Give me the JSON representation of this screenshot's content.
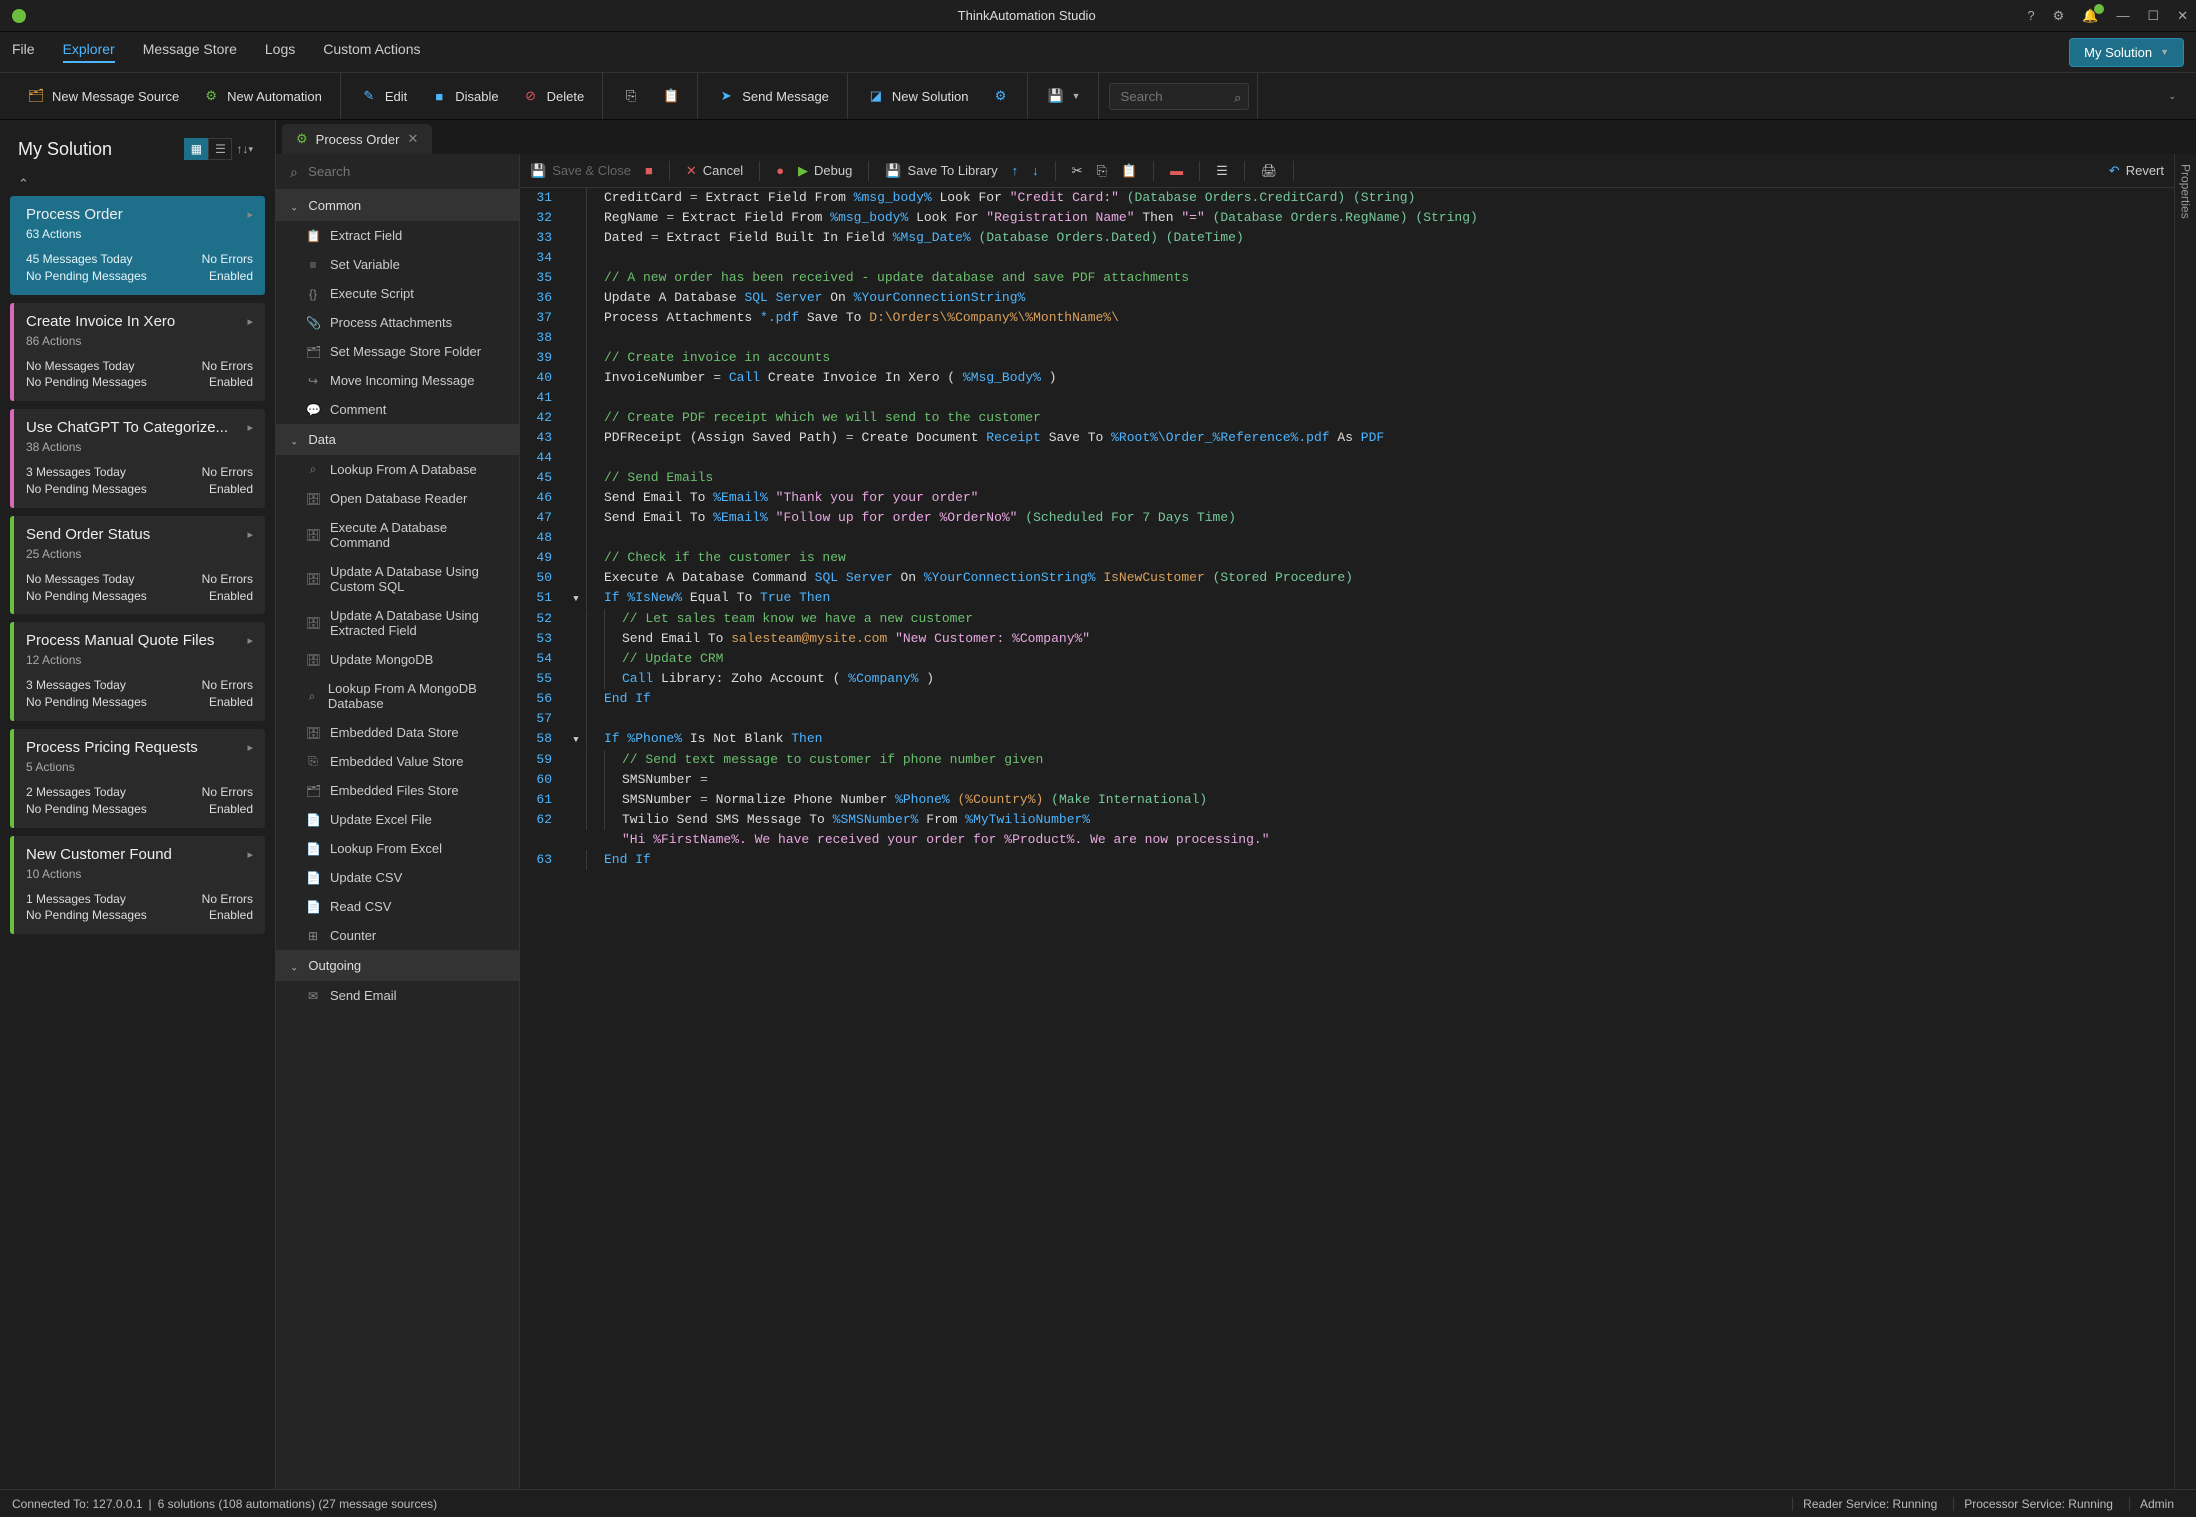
{
  "title": "ThinkAutomation Studio",
  "menubar": [
    "File",
    "Explorer",
    "Message Store",
    "Logs",
    "Custom Actions"
  ],
  "menubar_active": 1,
  "solution_dd": "My Solution",
  "toolbar": {
    "new_msg_src": "New Message Source",
    "new_auto": "New Automation",
    "edit": "Edit",
    "disable": "Disable",
    "delete": "Delete",
    "send_msg": "Send Message",
    "new_sol": "New Solution",
    "search_ph": "Search"
  },
  "left": {
    "title": "My Solution",
    "cards": [
      {
        "title": "Process Order",
        "sub": "63 Actions",
        "msg": "45 Messages Today",
        "pend": "No Pending Messages",
        "err": "No Errors",
        "en": "Enabled",
        "cls": "active"
      },
      {
        "title": "Create Invoice In Xero",
        "sub": "86 Actions",
        "msg": "No Messages Today",
        "pend": "No Pending Messages",
        "err": "No Errors",
        "en": "Enabled",
        "cls": "pink"
      },
      {
        "title": "Use ChatGPT To Categorize...",
        "sub": "38 Actions",
        "msg": "3 Messages Today",
        "pend": "No Pending Messages",
        "err": "No Errors",
        "en": "Enabled",
        "cls": "pink"
      },
      {
        "title": "Send Order Status",
        "sub": "25 Actions",
        "msg": "No Messages Today",
        "pend": "No Pending Messages",
        "err": "No Errors",
        "en": "Enabled",
        "cls": ""
      },
      {
        "title": "Process Manual Quote Files",
        "sub": "12 Actions",
        "msg": "3 Messages Today",
        "pend": "No Pending Messages",
        "err": "No Errors",
        "en": "Enabled",
        "cls": ""
      },
      {
        "title": "Process Pricing Requests",
        "sub": "5 Actions",
        "msg": "2 Messages Today",
        "pend": "No Pending Messages",
        "err": "No Errors",
        "en": "Enabled",
        "cls": ""
      },
      {
        "title": "New Customer Found",
        "sub": "10 Actions",
        "msg": "1 Messages Today",
        "pend": "No Pending Messages",
        "err": "No Errors",
        "en": "Enabled",
        "cls": ""
      }
    ]
  },
  "tab": {
    "label": "Process Order"
  },
  "action_search_ph": "Search",
  "action_groups": [
    {
      "name": "Common",
      "items": [
        {
          "i": "📋",
          "l": "Extract Field"
        },
        {
          "i": "≡",
          "l": "Set Variable"
        },
        {
          "i": "{}",
          "l": "Execute Script"
        },
        {
          "i": "📎",
          "l": "Process Attachments"
        },
        {
          "i": "🗂",
          "l": "Set Message Store Folder"
        },
        {
          "i": "↪",
          "l": "Move Incoming Message"
        },
        {
          "i": "💬",
          "l": "Comment"
        }
      ]
    },
    {
      "name": "Data",
      "items": [
        {
          "i": "⌕",
          "l": "Lookup From A Database"
        },
        {
          "i": "🗄",
          "l": "Open Database Reader"
        },
        {
          "i": "🗄",
          "l": "Execute A Database Command"
        },
        {
          "i": "🗄",
          "l": "Update A Database Using Custom SQL"
        },
        {
          "i": "🗄",
          "l": "Update A Database Using Extracted Field"
        },
        {
          "i": "🗄",
          "l": "Update MongoDB"
        },
        {
          "i": "⌕",
          "l": "Lookup From A MongoDB Database"
        },
        {
          "i": "🗄",
          "l": "Embedded Data Store"
        },
        {
          "i": "⎘",
          "l": "Embedded Value Store"
        },
        {
          "i": "🗂",
          "l": "Embedded Files Store"
        },
        {
          "i": "📄",
          "l": "Update Excel File"
        },
        {
          "i": "📄",
          "l": "Lookup From Excel"
        },
        {
          "i": "📄",
          "l": "Update CSV"
        },
        {
          "i": "📄",
          "l": "Read CSV"
        },
        {
          "i": "⊞",
          "l": "Counter"
        }
      ]
    },
    {
      "name": "Outgoing",
      "items": [
        {
          "i": "✉",
          "l": "Send Email"
        }
      ]
    }
  ],
  "code_toolbar": {
    "save_close": "Save & Close",
    "cancel": "Cancel",
    "debug": "Debug",
    "save_lib": "Save To Library",
    "revert": "Revert"
  },
  "code": [
    {
      "n": 31,
      "h": "<span class='c-fn'>CreditCard</span> <span class='c-op'>=</span> Extract Field From <span class='c-var'>%msg_body%</span> Look For <span class='c-str'>\"Credit Card:\"</span> <span class='c-db'>(Database Orders.CreditCard) (String)</span>"
    },
    {
      "n": 32,
      "h": "<span class='c-fn'>RegName</span> <span class='c-op'>=</span> Extract Field From <span class='c-var'>%msg_body%</span> Look For <span class='c-str'>\"Registration Name\"</span> Then <span class='c-str'>\"=\"</span> <span class='c-db'>(Database Orders.RegName) (String)</span>"
    },
    {
      "n": 33,
      "h": "<span class='c-fn'>Dated</span> <span class='c-op'>=</span> Extract Field Built In Field <span class='c-var'>%Msg_Date%</span> <span class='c-db'>(Database Orders.Dated) (DateTime)</span>"
    },
    {
      "n": 34,
      "h": ""
    },
    {
      "n": 35,
      "h": "<span class='c-cmt'>// A new order has been received - update database and save PDF attachments</span>"
    },
    {
      "n": 36,
      "h": "Update A Database <span class='c-var'>SQL Server</span> On <span class='c-var'>%YourConnectionString%</span>"
    },
    {
      "n": 37,
      "h": "Process Attachments <span class='c-var'>*.pdf</span> Save To <span class='c-kw'>D:\\Orders\\%Company%\\%MonthName%\\</span>"
    },
    {
      "n": 38,
      "h": ""
    },
    {
      "n": 39,
      "h": "<span class='c-cmt'>// Create invoice in accounts</span>"
    },
    {
      "n": 40,
      "h": "<span class='c-fn'>InvoiceNumber</span> <span class='c-op'>=</span> <span class='c-var'>Call</span> Create Invoice In Xero ( <span class='c-var'>%Msg_Body%</span> )"
    },
    {
      "n": 41,
      "h": ""
    },
    {
      "n": 42,
      "h": "<span class='c-cmt'>// Create PDF receipt which we will send to the customer</span>"
    },
    {
      "n": 43,
      "h": "<span class='c-fn'>PDFReceipt (Assign Saved Path)</span> <span class='c-op'>=</span> Create Document <span class='c-var'>Receipt</span> Save To <span class='c-var'>%Root%\\Order_%Reference%.pdf</span> As <span class='c-var'>PDF</span>"
    },
    {
      "n": 44,
      "h": ""
    },
    {
      "n": 45,
      "h": "<span class='c-cmt'>// Send Emails</span>"
    },
    {
      "n": 46,
      "h": "Send Email To <span class='c-var'>%Email%</span> <span class='c-str'>\"Thank you for your order\"</span>"
    },
    {
      "n": 47,
      "h": "Send Email To <span class='c-var'>%Email%</span> <span class='c-str'>\"Follow up for order %OrderNo%\"</span> <span class='c-db'>(Scheduled For 7 Days Time)</span>"
    },
    {
      "n": 48,
      "h": ""
    },
    {
      "n": 49,
      "h": "<span class='c-cmt'>// Check if the customer is new</span>"
    },
    {
      "n": 50,
      "h": "Execute A Database Command <span class='c-var'>SQL Server</span> On <span class='c-var'>%YourConnectionString%</span> <span class='c-kw'>IsNewCustomer</span> <span class='c-db'>(Stored Procedure)</span>"
    },
    {
      "n": 51,
      "f": 1,
      "h": "<span class='c-var'>If</span> <span class='c-var'>%IsNew%</span> Equal To <span class='c-var'>True</span> <span class='c-var'>Then</span>"
    },
    {
      "n": 52,
      "ind": 1,
      "h": "<span class='c-cmt'>// Let sales team know we have a new customer</span>"
    },
    {
      "n": 53,
      "ind": 1,
      "h": "Send Email To <span class='c-kw'>salesteam@mysite.com</span> <span class='c-str'>\"New Customer: %Company%\"</span>"
    },
    {
      "n": 54,
      "ind": 1,
      "h": "<span class='c-cmt'>// Update CRM</span>"
    },
    {
      "n": 55,
      "ind": 1,
      "h": "<span class='c-var'>Call</span> Library: Zoho Account ( <span class='c-var'>%Company%</span> )"
    },
    {
      "n": 56,
      "h": "<span class='c-var'>End If</span>"
    },
    {
      "n": 57,
      "h": ""
    },
    {
      "n": 58,
      "f": 1,
      "h": "<span class='c-var'>If</span> <span class='c-var'>%Phone%</span> Is Not Blank <span class='c-var'>Then</span>"
    },
    {
      "n": 59,
      "ind": 1,
      "h": "<span class='c-cmt'>// Send text message to customer if phone number given</span>"
    },
    {
      "n": 60,
      "ind": 1,
      "h": "<span class='c-fn'>SMSNumber</span> <span class='c-op'>=</span>"
    },
    {
      "n": 61,
      "ind": 1,
      "h": "<span class='c-fn'>SMSNumber</span> <span class='c-op'>=</span> Normalize Phone Number <span class='c-var'>%Phone%</span> <span class='c-kw'>(%Country%)</span> <span class='c-db'>(Make International)</span>"
    },
    {
      "n": 62,
      "ind": 1,
      "h": "Twilio Send SMS Message To <span class='c-var'>%SMSNumber%</span> From <span class='c-var'>%MyTwilioNumber%</span><br><span class='c-str'>\"Hi %FirstName%. We have received your order for %Product%. We are now processing.\"</span>"
    },
    {
      "n": 63,
      "h": "<span class='c-var'>End If</span>"
    }
  ],
  "properties_label": "Properties",
  "status": {
    "conn": "Connected To: 127.0.0.1",
    "sols": "6 solutions (108 automations) (27 message sources)",
    "reader": "Reader Service: Running",
    "proc": "Processor Service: Running",
    "user": "Admin"
  }
}
